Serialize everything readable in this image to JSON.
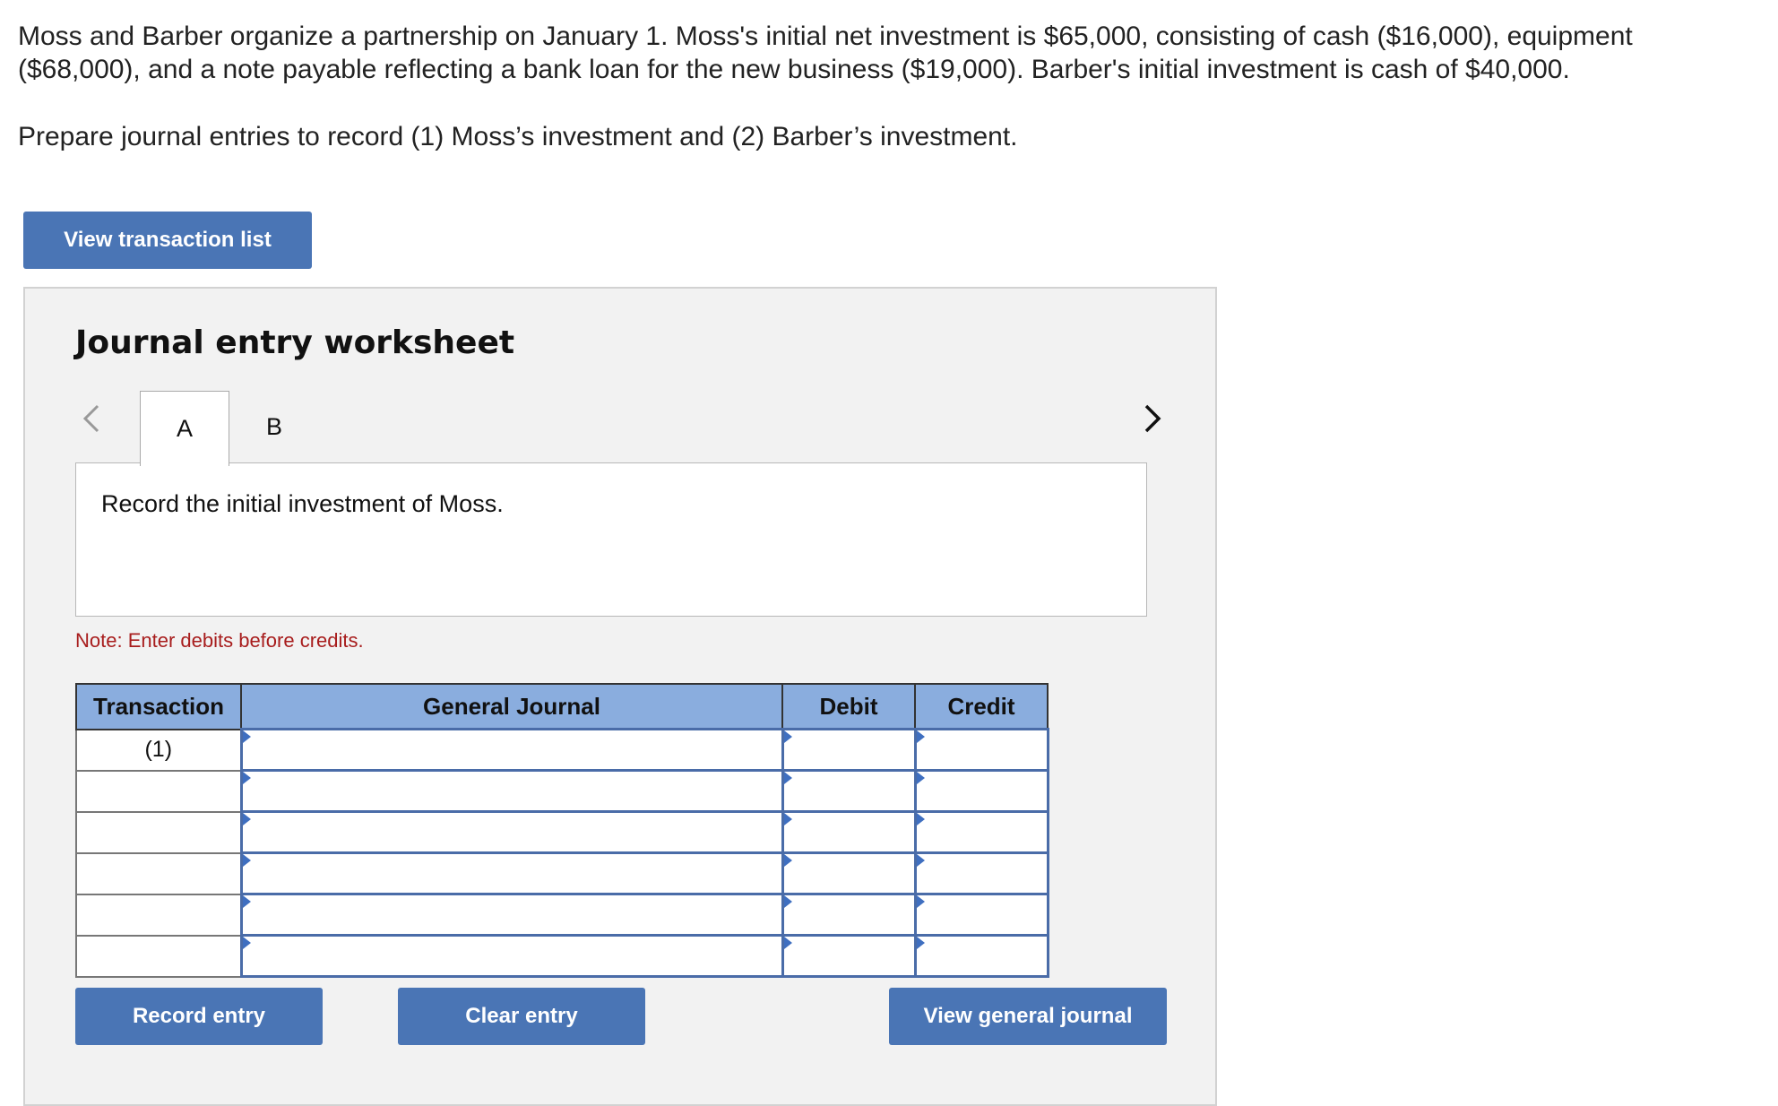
{
  "problem": {
    "text": "Moss and Barber organize a partnership on January 1. Moss's initial net investment is $65,000, consisting of cash ($16,000), equipment ($68,000), and a note payable reflecting a bank loan for the new business ($19,000). Barber's initial investment is cash of $40,000.",
    "instruction": "Prepare journal entries to record (1) Moss’s investment and (2) Barber’s investment."
  },
  "buttons": {
    "view_transaction_list": "View transaction list",
    "record_entry": "Record entry",
    "clear_entry": "Clear entry",
    "view_general_journal": "View general journal"
  },
  "worksheet": {
    "title": "Journal entry worksheet",
    "tabs": [
      {
        "label": "A",
        "active": true
      },
      {
        "label": "B",
        "active": false
      }
    ],
    "prompt": "Record the initial investment of Moss.",
    "note": "Note: Enter debits before credits."
  },
  "table": {
    "headers": [
      "Transaction",
      "General Journal",
      "Debit",
      "Credit"
    ],
    "rows": [
      {
        "transaction": "(1)",
        "general_journal": "",
        "debit": "",
        "credit": ""
      },
      {
        "transaction": "",
        "general_journal": "",
        "debit": "",
        "credit": ""
      },
      {
        "transaction": "",
        "general_journal": "",
        "debit": "",
        "credit": ""
      },
      {
        "transaction": "",
        "general_journal": "",
        "debit": "",
        "credit": ""
      },
      {
        "transaction": "",
        "general_journal": "",
        "debit": "",
        "credit": ""
      },
      {
        "transaction": "",
        "general_journal": "",
        "debit": "",
        "credit": ""
      }
    ]
  },
  "colors": {
    "button": "#4a75b5",
    "header": "#8aadde",
    "note": "#a81d1d",
    "panel": "#f2f2f2"
  },
  "icons": {
    "prev": "chevron-left-icon",
    "next": "chevron-right-icon",
    "dropdown_marker": "triangle-marker-icon"
  }
}
